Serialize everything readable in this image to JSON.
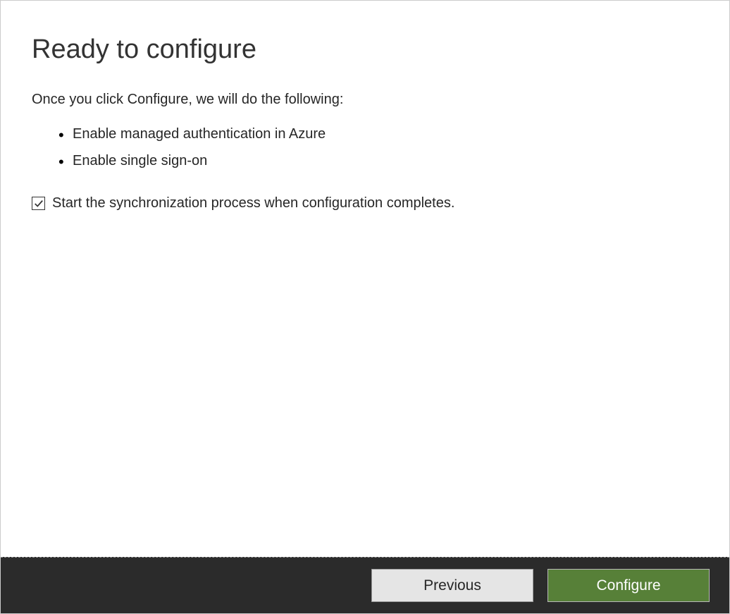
{
  "page": {
    "title": "Ready to configure",
    "intro": "Once you click Configure, we will do the following:",
    "actions": [
      "Enable managed authentication in Azure",
      "Enable single sign-on"
    ],
    "checkbox": {
      "label": "Start the synchronization process when configuration completes.",
      "checked": true
    }
  },
  "footer": {
    "previous_label": "Previous",
    "configure_label": "Configure"
  },
  "colors": {
    "primary_button": "#578038",
    "footer_bg": "#2b2b2b"
  }
}
